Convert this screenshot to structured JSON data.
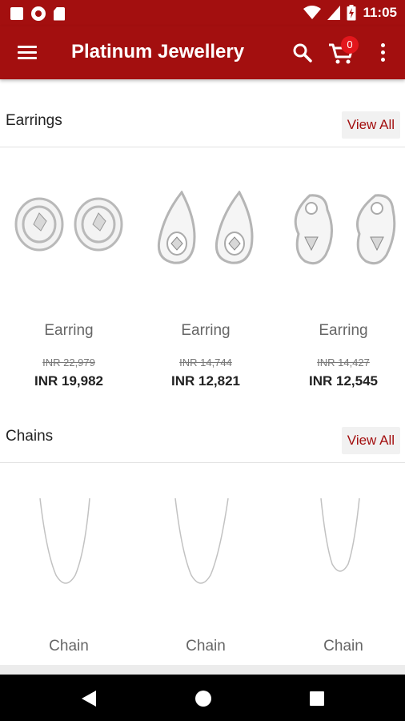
{
  "status_bar": {
    "time": "11:05",
    "icons": [
      "square-notification-icon",
      "record-icon",
      "sd-card-icon",
      "wifi-icon",
      "signal-icon",
      "battery-charging-icon"
    ]
  },
  "app_bar": {
    "title": "Platinum Jewellery",
    "cart_count": "0",
    "icons": [
      "menu-icon",
      "search-icon",
      "cart-icon",
      "more-vert-icon"
    ]
  },
  "sections": [
    {
      "title": "Earrings",
      "view_all": "View All",
      "products": [
        {
          "name": "Earring",
          "old_price": "INR 22,979",
          "new_price": "INR 19,982"
        },
        {
          "name": "Earring",
          "old_price": "INR 14,744",
          "new_price": "INR 12,821"
        },
        {
          "name": "Earring",
          "old_price": "INR 14,427",
          "new_price": "INR 12,545"
        }
      ]
    },
    {
      "title": "Chains",
      "view_all": "View All",
      "products": [
        {
          "name": "Chain"
        },
        {
          "name": "Chain"
        },
        {
          "name": "Chain"
        }
      ]
    }
  ],
  "colors": {
    "brand": "#a30f0f",
    "badge": "#e3161c",
    "link": "#a30f0f"
  },
  "nav_bar": {
    "icons": [
      "back-icon",
      "home-icon",
      "recents-icon"
    ]
  }
}
